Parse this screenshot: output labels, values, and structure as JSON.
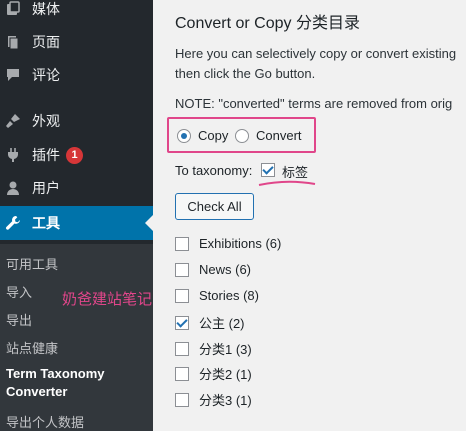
{
  "sidebar": {
    "items": [
      {
        "label": "媒体",
        "icon": "media-icon"
      },
      {
        "label": "页面",
        "icon": "page-icon"
      },
      {
        "label": "评论",
        "icon": "comment-icon"
      },
      {
        "label": "外观",
        "icon": "appearance-icon"
      },
      {
        "label": "插件",
        "icon": "plugin-icon",
        "badge": "1"
      },
      {
        "label": "用户",
        "icon": "user-icon"
      },
      {
        "label": "工具",
        "icon": "wrench-icon"
      }
    ],
    "submenu": [
      "可用工具",
      "导入",
      "导出",
      "站点健康",
      "Term Taxonomy Converter",
      "导出个人数据"
    ],
    "active_color": "#0073aa",
    "badge_color": "#d63638"
  },
  "main": {
    "title": "Convert or Copy 分类目录",
    "description_line1": "Here you can selectively copy or convert existing",
    "description_line2": "then click the Go button.",
    "note": "NOTE: \"converted\" terms are removed from orig",
    "mode": {
      "copy_label": "Copy",
      "convert_label": "Convert",
      "selected": "Copy"
    },
    "taxonomy_label": "To taxonomy:",
    "taxonomy_option": "标签",
    "taxonomy_checked": true,
    "check_all_label": "Check All",
    "terms": [
      {
        "label": "Exhibitions (6)",
        "checked": false
      },
      {
        "label": "News (6)",
        "checked": false
      },
      {
        "label": "Stories (8)",
        "checked": false
      },
      {
        "label": "公主 (2)",
        "checked": true
      },
      {
        "label": "分类1 (3)",
        "checked": false
      },
      {
        "label": "分类2 (1)",
        "checked": false
      },
      {
        "label": "分类3 (1)",
        "checked": false
      }
    ]
  },
  "watermark": "奶爸建站笔记",
  "highlight_color": "#e0468a"
}
